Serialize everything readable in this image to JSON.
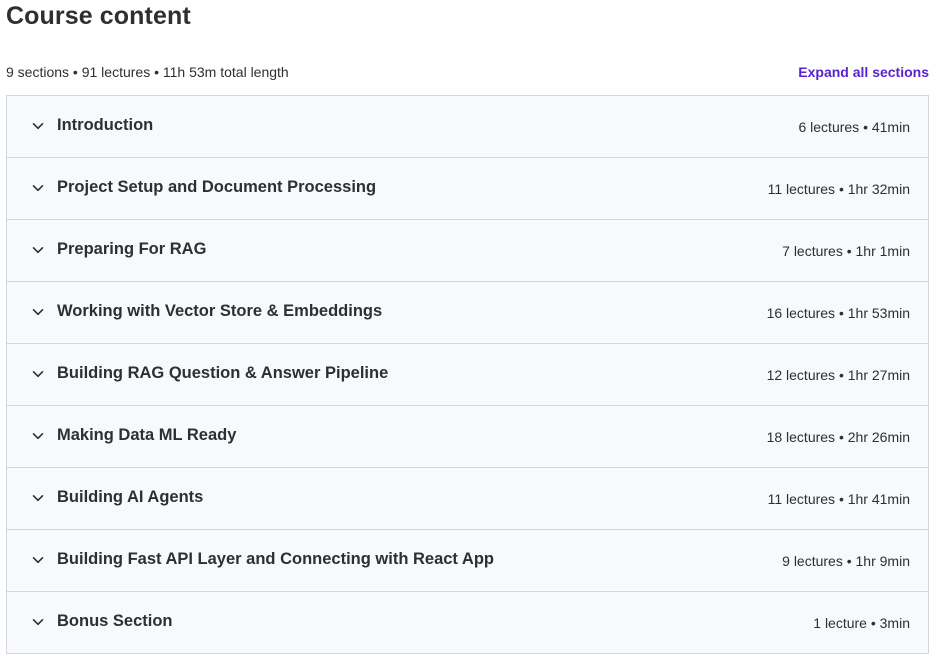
{
  "header": {
    "title": "Course content"
  },
  "summary": {
    "text": "9 sections • 91 lectures • 11h 53m total length",
    "expand_all_label": "Expand all sections"
  },
  "colors": {
    "accent": "#5624d0",
    "row_background": "#f7f9fa",
    "border": "#d1d7dc",
    "text": "#2d2f31"
  },
  "icons": {
    "section_toggle": "chevron-down-icon"
  },
  "sections": [
    {
      "title": "Introduction",
      "meta": "6 lectures • 41min"
    },
    {
      "title": "Project Setup and Document Processing",
      "meta": "11 lectures • 1hr 32min"
    },
    {
      "title": "Preparing For RAG",
      "meta": "7 lectures • 1hr 1min"
    },
    {
      "title": "Working with Vector Store & Embeddings",
      "meta": "16 lectures • 1hr 53min"
    },
    {
      "title": "Building RAG Question & Answer Pipeline",
      "meta": "12 lectures • 1hr 27min"
    },
    {
      "title": "Making Data ML Ready",
      "meta": "18 lectures • 2hr 26min"
    },
    {
      "title": "Building AI Agents",
      "meta": "11 lectures • 1hr 41min"
    },
    {
      "title": "Building Fast API Layer and Connecting with React App",
      "meta": "9 lectures • 1hr 9min"
    },
    {
      "title": "Bonus Section",
      "meta": "1 lecture • 3min"
    }
  ]
}
